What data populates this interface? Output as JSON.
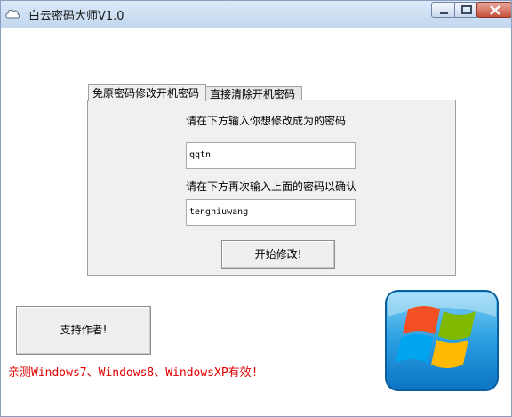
{
  "window": {
    "title": "白云密码大师V1.0",
    "icons": {
      "app": "cloud-icon",
      "minimize": "minimize-icon",
      "maximize": "maximize-icon",
      "close": "close-icon"
    }
  },
  "tabs": [
    {
      "label": "免原密码修改开机密码",
      "active": true
    },
    {
      "label": "直接清除开机密码",
      "active": false
    }
  ],
  "form": {
    "new_password_label": "请在下方输入你想修改成为的密码",
    "new_password_value": "qqtn",
    "confirm_password_label": "请在下方再次输入上面的密码以确认",
    "confirm_password_value": "tengniuwang",
    "submit_label": "开始修改!"
  },
  "support_button_label": "支持作者!",
  "note": "亲测Windows7、Windows8、WindowsXP有效!",
  "logo": "windows-logo",
  "colors": {
    "note": "#e00000",
    "panel": "#f0f0f0",
    "titlebar": "#c2d7ef"
  }
}
